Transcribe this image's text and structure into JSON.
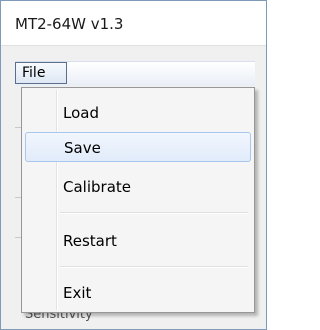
{
  "window": {
    "title": "MT2-64W v1.3"
  },
  "menubar": {
    "file_label": "File"
  },
  "file_menu": {
    "items": [
      {
        "label": "Load",
        "highlighted": false
      },
      {
        "label": "Save",
        "highlighted": true
      },
      {
        "label": "Calibrate",
        "highlighted": false
      },
      {
        "label": "Restart",
        "highlighted": false
      },
      {
        "label": "Exit",
        "highlighted": false
      }
    ]
  },
  "background": {
    "partial_label": "Sensitivity"
  },
  "colors": {
    "highlight_border": "#a8c7ee",
    "menu_background": "#f5f5f5",
    "window_border": "#7f9ab8"
  }
}
